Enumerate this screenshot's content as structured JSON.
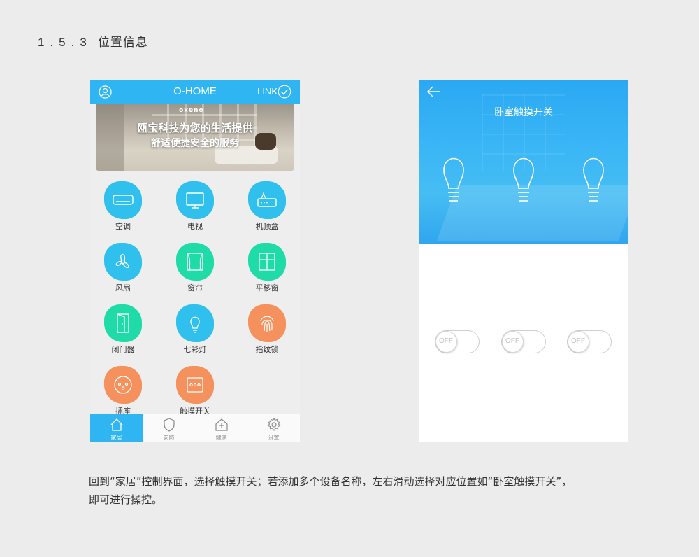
{
  "section": {
    "number": "1.5.3",
    "title": "位置信息"
  },
  "left_phone": {
    "header": {
      "title": "O-HOME",
      "link_label": "LINK"
    },
    "banner": {
      "brand": "ouaxo",
      "line1": "瓯宝科技为您的生活提供",
      "line2": "舒适便捷安全的服务"
    },
    "devices": [
      {
        "label": "空调",
        "icon": "air-conditioner-icon",
        "color": "#2fc0ee"
      },
      {
        "label": "电视",
        "icon": "tv-icon",
        "color": "#2fc0ee"
      },
      {
        "label": "机顶盒",
        "icon": "set-top-box-icon",
        "color": "#2fc0ee"
      },
      {
        "label": "风扇",
        "icon": "fan-icon",
        "color": "#2fc0ee"
      },
      {
        "label": "窗帘",
        "icon": "curtain-icon",
        "color": "#1fdba8"
      },
      {
        "label": "平移窗",
        "icon": "sliding-window-icon",
        "color": "#1fdba8"
      },
      {
        "label": "闭门器",
        "icon": "door-closer-icon",
        "color": "#1fdba8"
      },
      {
        "label": "七彩灯",
        "icon": "bulb-icon",
        "color": "#2fc0ee"
      },
      {
        "label": "指纹锁",
        "icon": "fingerprint-icon",
        "color": "#f5915c"
      },
      {
        "label": "插座",
        "icon": "socket-icon",
        "color": "#f5915c"
      },
      {
        "label": "触摸开关",
        "icon": "touch-switch-icon",
        "color": "#f5915c"
      }
    ],
    "tabs": [
      {
        "label": "家居",
        "icon": "home-icon",
        "active": true
      },
      {
        "label": "安防",
        "icon": "shield-icon",
        "active": false
      },
      {
        "label": "健康",
        "icon": "health-icon",
        "active": false
      },
      {
        "label": "设置",
        "icon": "gear-icon",
        "active": false
      }
    ]
  },
  "right_phone": {
    "title": "卧室触摸开关",
    "switches": [
      {
        "state": "OFF"
      },
      {
        "state": "OFF"
      },
      {
        "state": "OFF"
      }
    ]
  },
  "caption": {
    "line1": "回到“家居”控制界面，选择触摸开关；若添加多个设备名称，左右滑动选择对应位置如“卧室触摸开关”，",
    "line2": "即可进行操控。"
  },
  "colors": {
    "primary": "#2fb5f2",
    "green": "#1fdba8",
    "orange": "#f5915c",
    "background": "#ececec"
  }
}
